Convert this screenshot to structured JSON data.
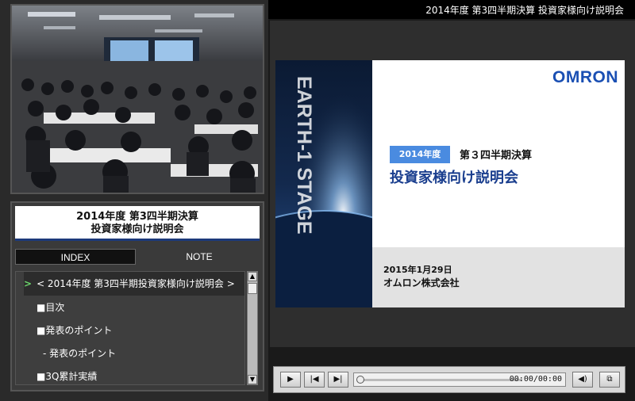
{
  "header": {
    "title": "2014年度 第3四半期決算 投資家様向け説明会"
  },
  "video": {
    "label": ""
  },
  "event": {
    "title_line1": "2014年度 第3四半期決算",
    "title_line2": "投資家様向け説明会"
  },
  "tabs": {
    "index": "INDEX",
    "note": "NOTE"
  },
  "index_items": [
    {
      "label": "< 2014年度 第3四半期投資家様向け説明会 >",
      "active": true
    },
    {
      "label": "■目次"
    },
    {
      "label": "■発表のポイント"
    },
    {
      "label": "- 発表のポイント"
    },
    {
      "label": "■3Q累計実績"
    }
  ],
  "slide": {
    "logo": "OMRON",
    "vertical_text": "EARTH-1 STAGE",
    "year_badge": "2014年度",
    "heading1": "第３四半期決算",
    "heading2": "投資家様向け説明会",
    "date": "2015年1月29日",
    "company": "オムロン株式会社"
  },
  "player": {
    "time": "00:00/00:00",
    "icons": {
      "play": "play-icon",
      "prev": "skip-back-icon",
      "next": "skip-forward-icon",
      "volume": "volume-icon",
      "fullscreen": "fullscreen-icon"
    }
  }
}
